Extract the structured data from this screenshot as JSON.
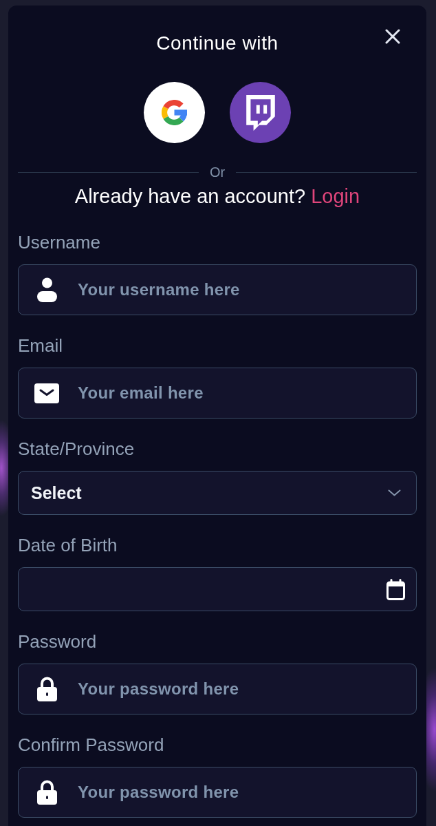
{
  "dialog": {
    "title": "Continue with",
    "social_buttons": [
      {
        "kind": "google"
      },
      {
        "kind": "twitch"
      }
    ],
    "divider_label": "Or",
    "login_prompt": {
      "text": "Already have an account?",
      "link": "Login"
    }
  },
  "fields": [
    {
      "kind": "user",
      "label": "Username",
      "placeholder": "Your username here"
    },
    {
      "kind": "email",
      "label": "Email",
      "placeholder": "Your email here"
    },
    {
      "kind": "select",
      "label": "State/Province",
      "value": "Select"
    },
    {
      "kind": "date",
      "label": "Date of Birth"
    },
    {
      "kind": "password",
      "label": "Password",
      "placeholder": "Your password here"
    },
    {
      "kind": "password",
      "label": "Confirm Password",
      "placeholder": "Your password here"
    }
  ]
}
